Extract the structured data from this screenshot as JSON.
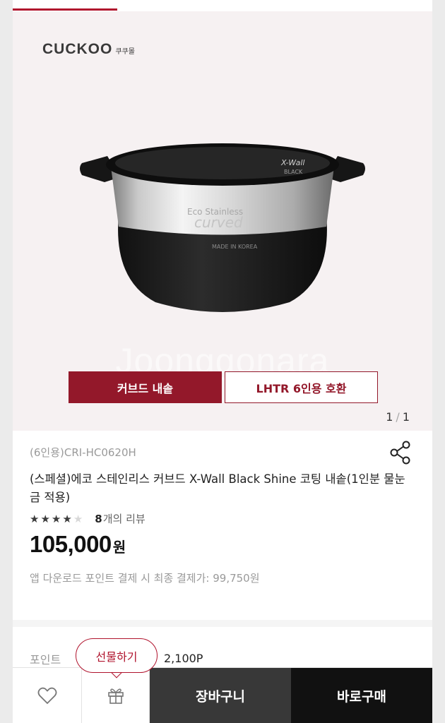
{
  "brand": {
    "name": "CUCKOO",
    "name_ko": "쿠쿠몰"
  },
  "gallery": {
    "watermark": "Joonggonara",
    "tags": [
      "커브드 내솥",
      "LHTR 6인용 호환"
    ],
    "counter": {
      "current": "1",
      "separator": "/",
      "total": "1"
    },
    "product_print": {
      "eco": "Eco Stainless",
      "coating": "curved",
      "origin": "MADE IN KOREA",
      "wall": "X-Wall",
      "wall_sub": "BLACK"
    }
  },
  "product": {
    "model": "(6인용)CRI-HC0620H",
    "title": "(스페셜)에코 스테인리스 커브드 X-Wall Black Shine 코팅 내솥(1인분 물눈금 적용)",
    "rating": 4,
    "rating_max": 5,
    "review_count": "8",
    "review_suffix": "개의 리뷰",
    "price": "105,000",
    "price_unit": "원",
    "app_price_note": "앱 다운로드 포인트 결제 시 최종 결제가: 99,750원"
  },
  "points": {
    "label": "포인트",
    "value": "2,100P"
  },
  "bottom_bar": {
    "gift_tooltip": "선물하기",
    "cart": "장바구니",
    "buy": "바로구매"
  },
  "colors": {
    "accent": "#93182a",
    "cart_bg": "#383838",
    "buy_bg": "#111111"
  },
  "icons": {
    "share": "share-icon",
    "wish": "heart-icon",
    "gift": "gift-icon",
    "star": "star-icon"
  }
}
